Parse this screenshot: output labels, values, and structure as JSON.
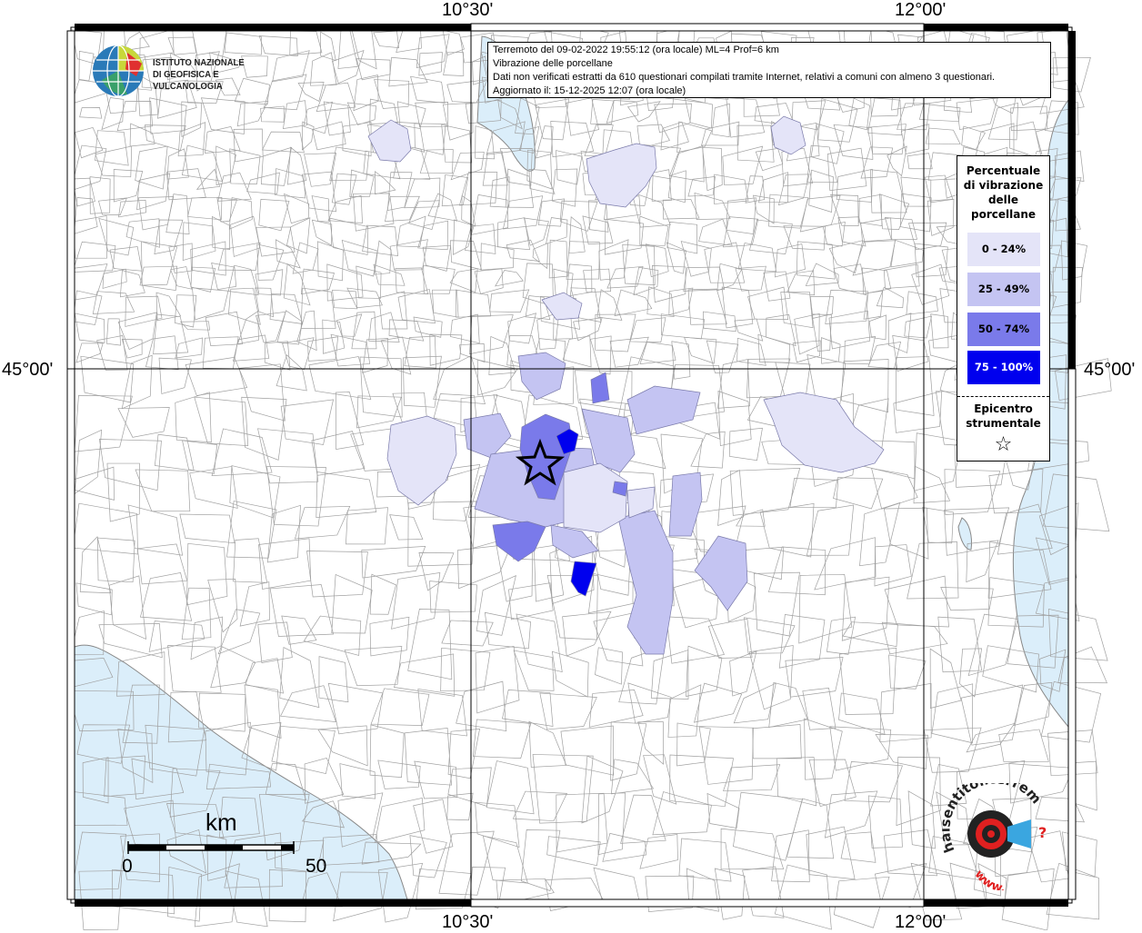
{
  "coordinates": {
    "top_left_lon": "10°30'",
    "top_right_lon": "12°00'",
    "bottom_left_lon": "10°30'",
    "bottom_right_lon": "12°00'",
    "left_lat": "45°00'",
    "right_lat": "45°00'"
  },
  "title_box": {
    "line1": "Terremoto del 09-02-2022 19:55:12 (ora locale) ML=4 Prof=6 km",
    "line2": "Vibrazione delle porcellane",
    "line3": "Dati non verificati estratti da 610 questionari compilati tramite Internet, relativi a comuni con almeno 3 questionari.",
    "line4": "Aggiornato il: 15-12-2025 12:07 (ora locale)"
  },
  "logo": {
    "line1": "ISTITUTO NAZIONALE",
    "line2": "DI GEOFISICA E VULCANOLOGIA"
  },
  "legend": {
    "title_lines": [
      "Percentuale",
      "di vibrazione",
      "delle",
      "porcellane"
    ],
    "classes": [
      {
        "label": "0 - 24%",
        "color": "#e4e4f8"
      },
      {
        "label": "25 - 49%",
        "color": "#c4c4f2"
      },
      {
        "label": "50 - 74%",
        "color": "#7a7aea"
      },
      {
        "label": "75 - 100%",
        "color": "#0000ee"
      }
    ],
    "epicenter_lines": [
      "Epicentro",
      "strumentale"
    ],
    "epicenter_symbol": "☆"
  },
  "scale_bar": {
    "unit": "km",
    "start": "0",
    "end": "50"
  },
  "branding": {
    "site": "haisentitoilterremoto.it",
    "prefix": "www.",
    "question": "?"
  },
  "colors": {
    "sea": "#dbeefa",
    "border": "#000000",
    "boundary": "#9a9a9a"
  }
}
